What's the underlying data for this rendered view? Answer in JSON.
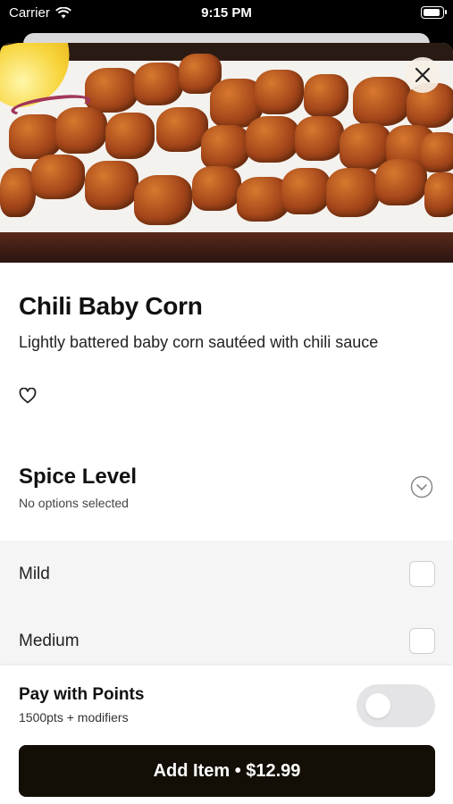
{
  "status_bar": {
    "carrier": "Carrier",
    "time": "9:15 PM"
  },
  "item": {
    "name": "Chili Baby Corn",
    "description": "Lightly battered baby corn sautéed with chili sauce"
  },
  "spice_section": {
    "title": "Spice Level",
    "subtitle": "No options selected",
    "options": [
      {
        "label": "Mild",
        "checked": false
      },
      {
        "label": "Medium",
        "checked": false
      }
    ]
  },
  "points": {
    "title": "Pay with Points",
    "subtitle": "1500pts + modifiers",
    "enabled": false
  },
  "add_button": {
    "label": "Add Item • $12.99"
  },
  "icons": {
    "close": "close-icon",
    "favorite": "heart-icon",
    "expand": "chevron-down-circle-icon",
    "wifi": "wifi-icon",
    "battery": "battery-icon"
  }
}
